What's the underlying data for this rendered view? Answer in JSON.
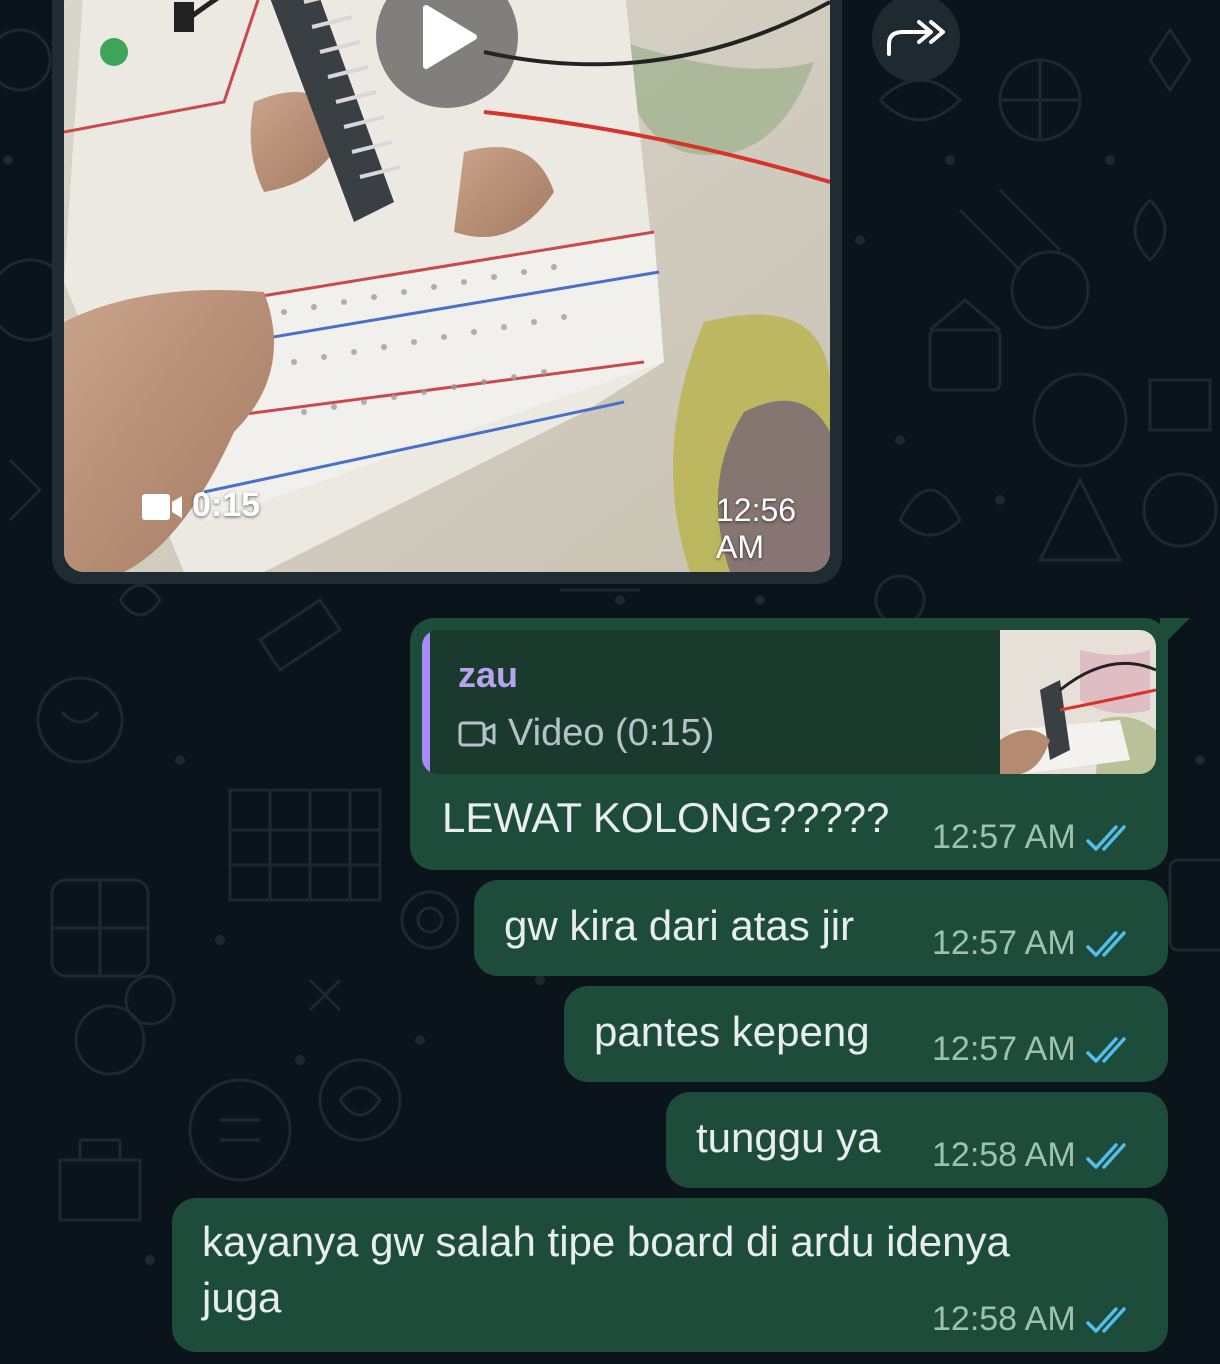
{
  "video_message": {
    "duration": "0:15",
    "time": "12:56 AM",
    "icons": {
      "play": "play-icon",
      "video": "video-camera-icon",
      "forward": "forward-icon"
    }
  },
  "messages": [
    {
      "reply": {
        "author": "zau",
        "label": "Video (0:15)"
      },
      "text": "LEWAT KOLONG?????",
      "time": "12:57 AM"
    },
    {
      "text": "gw kira dari atas jir",
      "time": "12:57 AM"
    },
    {
      "text": "pantes kepeng",
      "time": "12:57 AM"
    },
    {
      "text": "tunggu ya",
      "time": "12:58 AM"
    },
    {
      "text_line1": "kayanya gw salah tipe board di ardu idenya",
      "text_line2": "juga",
      "time": "12:58 AM"
    }
  ],
  "colors": {
    "background": "#0b141a",
    "outgoing_bubble": "#1d4d3a",
    "read_ticks": "#53bdeb",
    "quote_accent": "#a78bfa"
  }
}
